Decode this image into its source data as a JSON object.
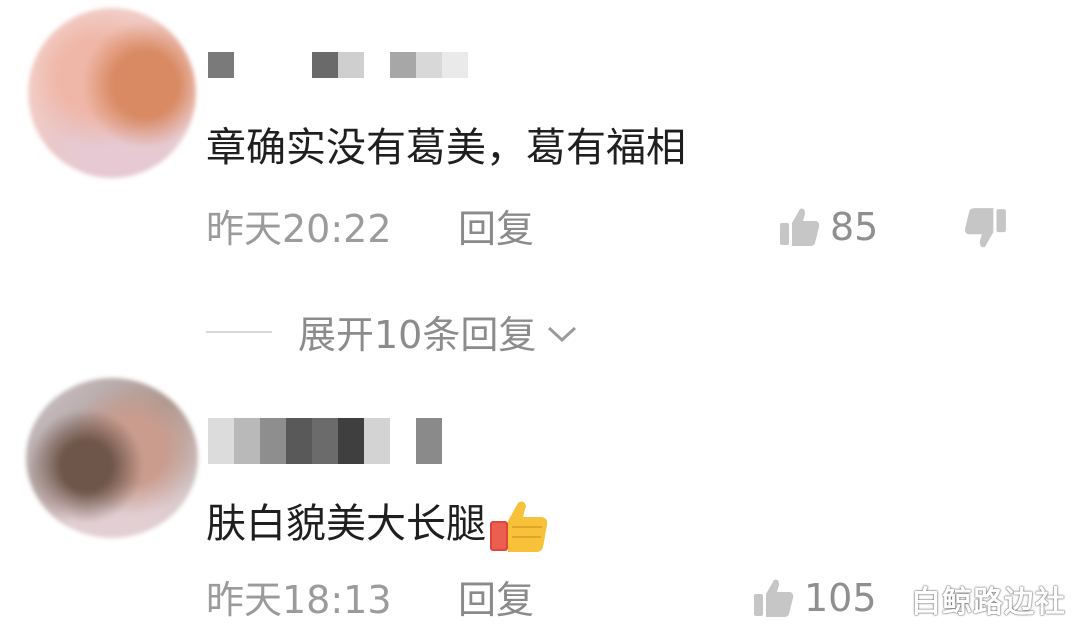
{
  "comments": [
    {
      "text": "章确实没有葛美，葛有福相",
      "time": "昨天20:22",
      "reply_label": "回复",
      "likes": "85",
      "has_dislike": true,
      "emoji": ""
    },
    {
      "text": "肤白貌美大长腿",
      "time": "昨天18:13",
      "reply_label": "回复",
      "likes": "105",
      "has_dislike": false,
      "emoji": "thumbs-up-emoji"
    }
  ],
  "expand_replies": {
    "label": "展开10条回复",
    "icon": "chevron-down-icon"
  },
  "watermark": "白鲸路边社",
  "colors": {
    "text_primary": "#1f1f1f",
    "text_secondary": "#9b9b9b",
    "divider": "#d8d8d8",
    "emoji_yellow": "#f7c23a",
    "emoji_red": "#e0443a"
  }
}
